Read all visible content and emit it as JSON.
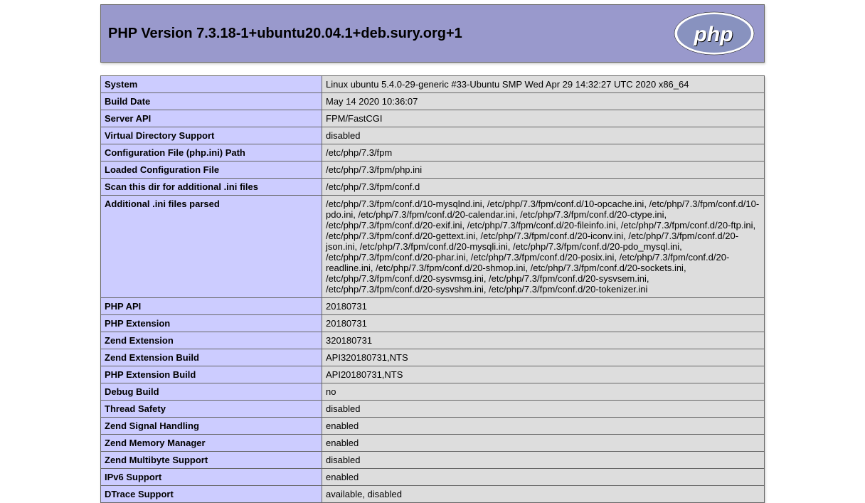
{
  "header": {
    "title": "PHP Version 7.3.18-1+ubuntu20.04.1+deb.sury.org+1"
  },
  "rows": [
    {
      "key": "System",
      "value": "Linux ubuntu 5.4.0-29-generic #33-Ubuntu SMP Wed Apr 29 14:32:27 UTC 2020 x86_64"
    },
    {
      "key": "Build Date",
      "value": "May 14 2020 10:36:07"
    },
    {
      "key": "Server API",
      "value": "FPM/FastCGI"
    },
    {
      "key": "Virtual Directory Support",
      "value": "disabled"
    },
    {
      "key": "Configuration File (php.ini) Path",
      "value": "/etc/php/7.3/fpm"
    },
    {
      "key": "Loaded Configuration File",
      "value": "/etc/php/7.3/fpm/php.ini"
    },
    {
      "key": "Scan this dir for additional .ini files",
      "value": "/etc/php/7.3/fpm/conf.d"
    },
    {
      "key": "Additional .ini files parsed",
      "value": "/etc/php/7.3/fpm/conf.d/10-mysqlnd.ini, /etc/php/7.3/fpm/conf.d/10-opcache.ini, /etc/php/7.3/fpm/conf.d/10-pdo.ini, /etc/php/7.3/fpm/conf.d/20-calendar.ini, /etc/php/7.3/fpm/conf.d/20-ctype.ini, /etc/php/7.3/fpm/conf.d/20-exif.ini, /etc/php/7.3/fpm/conf.d/20-fileinfo.ini, /etc/php/7.3/fpm/conf.d/20-ftp.ini, /etc/php/7.3/fpm/conf.d/20-gettext.ini, /etc/php/7.3/fpm/conf.d/20-iconv.ini, /etc/php/7.3/fpm/conf.d/20-json.ini, /etc/php/7.3/fpm/conf.d/20-mysqli.ini, /etc/php/7.3/fpm/conf.d/20-pdo_mysql.ini, /etc/php/7.3/fpm/conf.d/20-phar.ini, /etc/php/7.3/fpm/conf.d/20-posix.ini, /etc/php/7.3/fpm/conf.d/20-readline.ini, /etc/php/7.3/fpm/conf.d/20-shmop.ini, /etc/php/7.3/fpm/conf.d/20-sockets.ini, /etc/php/7.3/fpm/conf.d/20-sysvmsg.ini, /etc/php/7.3/fpm/conf.d/20-sysvsem.ini, /etc/php/7.3/fpm/conf.d/20-sysvshm.ini, /etc/php/7.3/fpm/conf.d/20-tokenizer.ini"
    },
    {
      "key": "PHP API",
      "value": "20180731"
    },
    {
      "key": "PHP Extension",
      "value": "20180731"
    },
    {
      "key": "Zend Extension",
      "value": "320180731"
    },
    {
      "key": "Zend Extension Build",
      "value": "API320180731,NTS"
    },
    {
      "key": "PHP Extension Build",
      "value": "API20180731,NTS"
    },
    {
      "key": "Debug Build",
      "value": "no"
    },
    {
      "key": "Thread Safety",
      "value": "disabled"
    },
    {
      "key": "Zend Signal Handling",
      "value": "enabled"
    },
    {
      "key": "Zend Memory Manager",
      "value": "enabled"
    },
    {
      "key": "Zend Multibyte Support",
      "value": "disabled"
    },
    {
      "key": "IPv6 Support",
      "value": "enabled"
    },
    {
      "key": "DTrace Support",
      "value": "available, disabled"
    }
  ]
}
